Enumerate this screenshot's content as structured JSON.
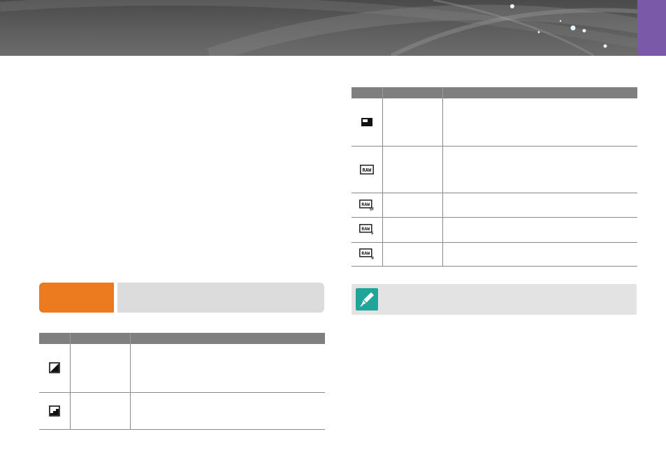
{
  "header": {
    "background_color": "#5a5a5a",
    "tab_color": "#7a5aa8"
  },
  "left_section": {
    "badge_color": "#ec7a1e",
    "badge_label": "",
    "badge_description": "",
    "table": {
      "headers": [
        "",
        "",
        ""
      ],
      "rows": [
        {
          "icon": "tone-diagonal-icon",
          "name": "",
          "description": ""
        },
        {
          "icon": "tone-stepped-icon",
          "name": "",
          "description": ""
        }
      ]
    }
  },
  "right_section": {
    "table": {
      "headers": [
        "",
        "",
        ""
      ],
      "rows": [
        {
          "icon": "image-size-small-icon",
          "name": "",
          "description": ""
        },
        {
          "icon": "raw-icon",
          "name": "",
          "description": ""
        },
        {
          "icon": "raw-sf-icon",
          "name": "",
          "description": ""
        },
        {
          "icon": "raw-f-icon",
          "name": "",
          "description": ""
        },
        {
          "icon": "raw-n-icon",
          "name": "",
          "description": ""
        }
      ]
    },
    "note": {
      "icon": "note-pen-icon",
      "icon_color": "#1fa59a",
      "text": ""
    }
  }
}
